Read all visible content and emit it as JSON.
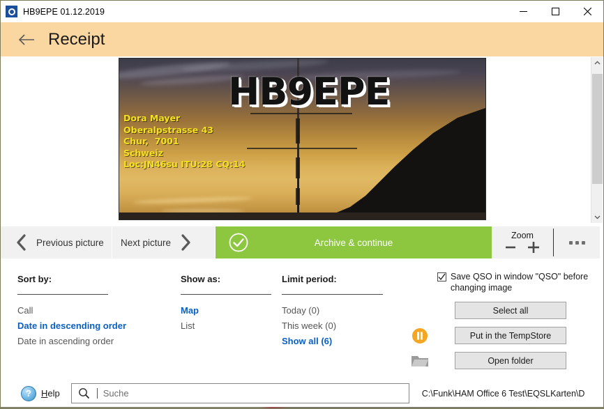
{
  "window": {
    "title": "HB9EPE 01.12.2019",
    "app_icon": "ring-logo-icon",
    "minimize": "minimize-icon",
    "maximize": "maximize-icon",
    "close": "close-icon"
  },
  "header": {
    "back": "back-arrow-icon",
    "title": "Receipt",
    "accent_color": "#fad6a0"
  },
  "card": {
    "callsign": "HB9EPE",
    "address": "Dora Mayer\nOberalpstrasse 43\nChur,  7001\nSchweiz\nLoc:JN46su ITU:28 CQ:14",
    "address_lines": [
      "Dora Mayer",
      "Oberalpstrasse 43",
      "Chur,  7001",
      "Schweiz",
      "Loc:JN46su ITU:28 CQ:14"
    ],
    "text_color": "#f5e11e",
    "callsign_color": "#121212"
  },
  "scrollbar": {
    "up": "chevron-up-icon",
    "down": "chevron-down-icon"
  },
  "toolbar": {
    "previous_label": "Previous picture",
    "previous_icon": "chevron-left-icon",
    "next_label": "Next picture",
    "next_icon": "chevron-right-icon",
    "archive_label": "Archive & continue",
    "archive_icon": "check-circle-icon",
    "archive_color": "#8dc63f",
    "zoom_label": "Zoom",
    "zoom_out": "minus-icon",
    "zoom_in": "plus-icon",
    "more": "ellipsis-icon"
  },
  "options": {
    "sort": {
      "title": "Sort by:",
      "items": [
        {
          "label": "Call",
          "selected": false
        },
        {
          "label": "Date in descending order",
          "selected": true
        },
        {
          "label": "Date in ascending order",
          "selected": false
        }
      ]
    },
    "show_as": {
      "title": "Show as:",
      "items": [
        {
          "label": "Map",
          "selected": true
        },
        {
          "label": "List",
          "selected": false
        }
      ]
    },
    "limit_period": {
      "title": "Limit period:",
      "items": [
        {
          "label": "Today (0)",
          "selected": false
        },
        {
          "label": "This week (0)",
          "selected": false
        },
        {
          "label": "Show all (6)",
          "selected": true
        }
      ]
    },
    "selected_color": "#0b5fc1"
  },
  "right_panel": {
    "checkbox_label": "Save QSO in window \"QSO\" before changing image",
    "checkbox_checked": true,
    "buttons": [
      {
        "label": "Select all",
        "icon": ""
      },
      {
        "label": "Put in the TempStore",
        "icon": "pause-icon"
      },
      {
        "label": "Open folder",
        "icon": "folder-icon"
      }
    ]
  },
  "bottom": {
    "help_icon": "question-mark-icon",
    "help_label_accel": "H",
    "help_label_rest": "elp",
    "search_icon": "search-icon",
    "search_value": "",
    "search_placeholder": "Suche",
    "path": "C:\\Funk\\HAM Office 6 Test\\EQSLKarten\\D"
  }
}
